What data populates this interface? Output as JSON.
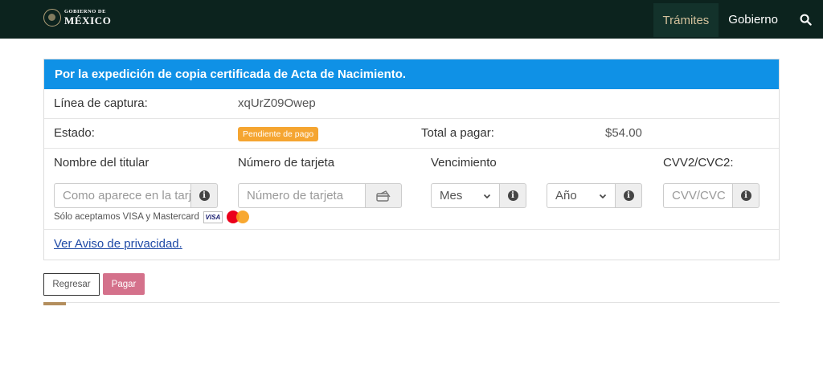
{
  "header": {
    "logo_line1": "GOBIERNO DE",
    "logo_line2": "MÉXICO",
    "nav": [
      {
        "label": "Trámites",
        "active": true
      },
      {
        "label": "Gobierno",
        "active": false
      }
    ],
    "search_icon": "search-icon"
  },
  "panel": {
    "title": "Por la expedición de copia certificada de Acta de Nacimiento.",
    "linea_label": "Línea de captura:",
    "linea_value": "xqUrZ09Owep",
    "estado_label": "Estado:",
    "estado_badge": "Pendiente de pago",
    "total_label": "Total a pagar:",
    "total_value": "$54.00"
  },
  "form": {
    "titular_label": "Nombre del titular",
    "titular_placeholder": "Como aparece en la tarjeta",
    "tarjeta_label": "Número de tarjeta",
    "tarjeta_placeholder": "Número de tarjeta",
    "vencimiento_label": "Vencimiento",
    "mes_value": "Mes",
    "anio_value": "Año",
    "cvv_label": "CVV2/CVC2:",
    "cvv_placeholder": "CVV/CVC",
    "accepted_text": "Sólo aceptamos VISA y Mastercard",
    "visa_text": "VISA"
  },
  "privacy_link": "Ver Aviso de privacidad.",
  "buttons": {
    "back": "Regresar",
    "pay": "Pagar"
  },
  "colors": {
    "header_bg": "#0c231e",
    "panel_head": "#0f91e6",
    "badge": "#f5a531",
    "pay_button": "#d4718b",
    "accent": "#b38e5d"
  }
}
